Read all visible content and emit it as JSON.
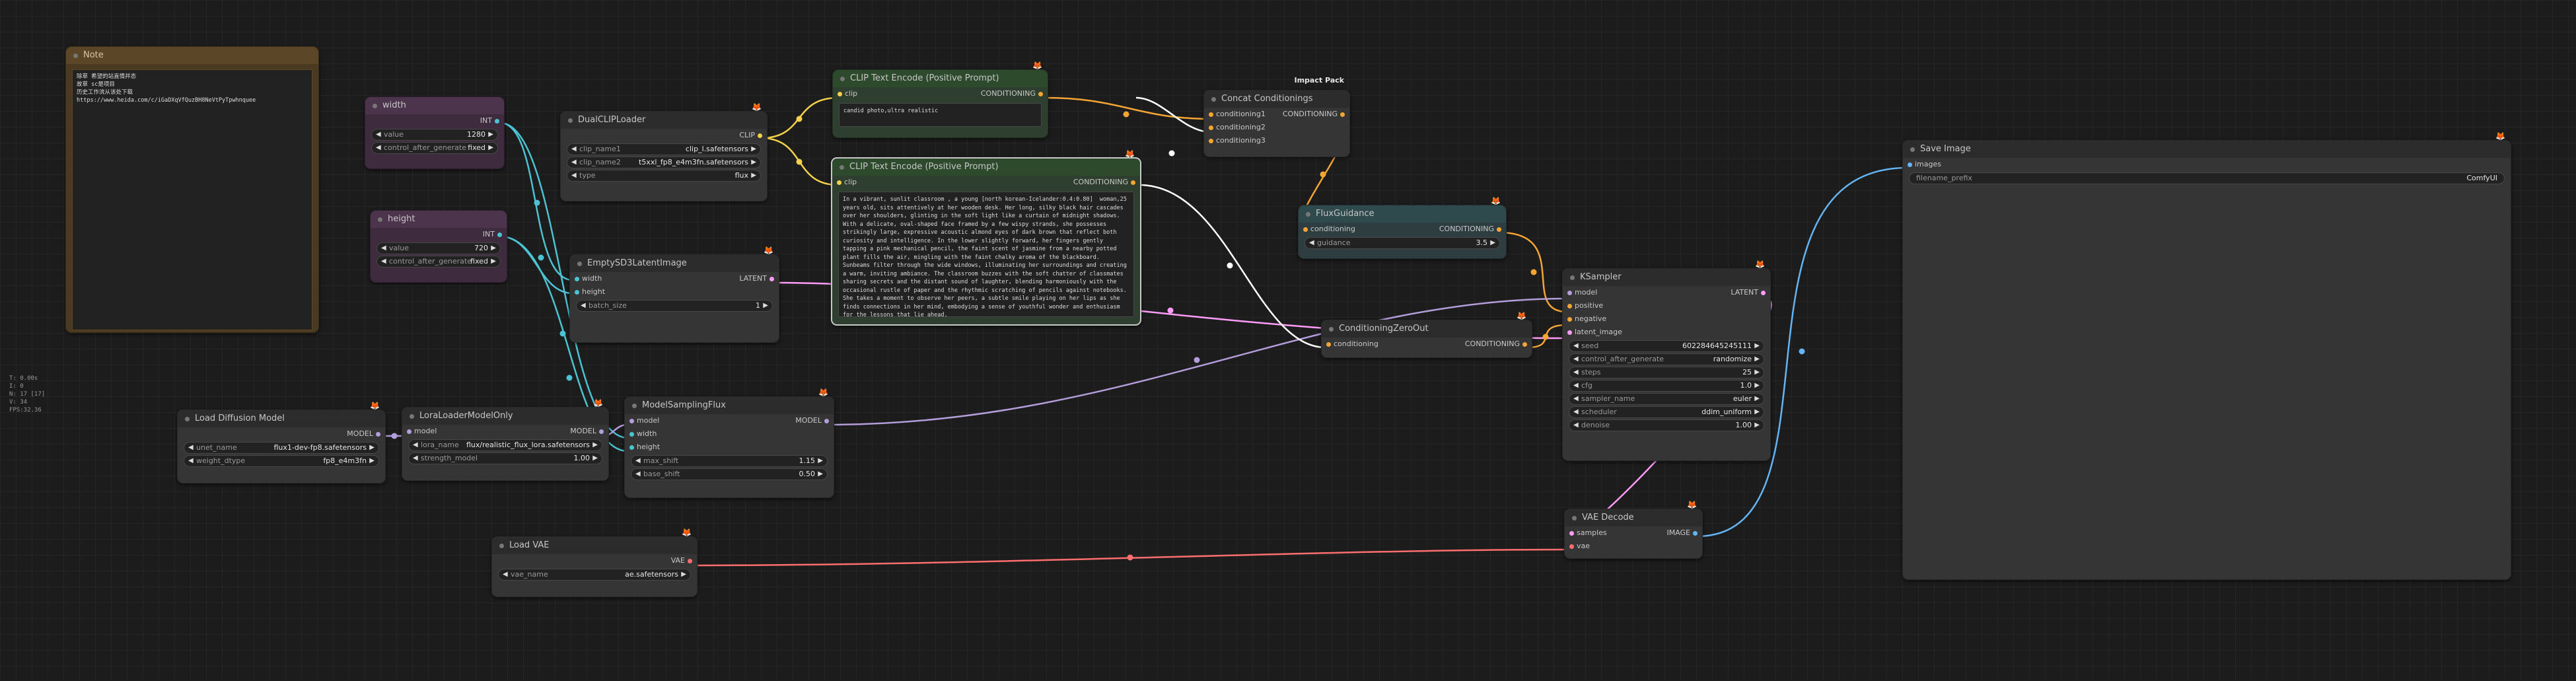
{
  "stats": [
    "T: 0.00s",
    "I: 0",
    "N: 17 [17]",
    "V: 34",
    "FPS:32.36"
  ],
  "note": {
    "title": "Note",
    "text": "除草 希望的站直情并态\n故草 sc是项目\n历史工作流从该处下载\nhttps://www.heida.com/c/iGaDXqVfQuzBH8NeVtPyTpwhnquee"
  },
  "width": {
    "title": "width",
    "out": "INT",
    "widgets": [
      {
        "name": "value",
        "value": "1280"
      },
      {
        "name": "control_after_generate",
        "value": "fixed"
      }
    ]
  },
  "height": {
    "title": "height",
    "out": "INT",
    "widgets": [
      {
        "name": "value",
        "value": "720"
      },
      {
        "name": "control_after_generate",
        "value": "fixed"
      }
    ]
  },
  "dualclip": {
    "title": "DualCLIPLoader",
    "out": "CLIP",
    "widgets": [
      {
        "name": "clip_name1",
        "value": "clip_l.safetensors"
      },
      {
        "name": "clip_name2",
        "value": "t5xxl_fp8_e4m3fn.safetensors"
      },
      {
        "name": "type",
        "value": "flux"
      }
    ]
  },
  "clip_small": {
    "title": "CLIP Text Encode (Positive Prompt)",
    "in": "clip",
    "out": "CONDITIONING",
    "text": "candid photo,ultra realistic"
  },
  "clip_big": {
    "title": "CLIP Text Encode (Positive Prompt)",
    "in": "clip",
    "out": "CONDITIONING",
    "text": "In a vibrant, sunlit classroom , a young [north korean-Icelander:0.4:0.80]  woman,25 years old, sits attentively at her wooden desk. Her long, silky black hair cascades over her shoulders, glinting in the soft light like a curtain of midnight shadows. With a delicate, oval-shaped face framed by a few wispy strands, she possesses strikingly large, expressive acoustic almond eyes of dark brown that reflect both curiosity and intelligence. In the lower slightly forward, her fingers gently tapping a pink mechanical pencil, the faint scent of jasmine from a nearby potted plant fills the air, mingling with the faint chalky aroma of the blackboard. Sunbeams filter through the wide windows, illuminating her surroundings and creating a warm, inviting ambiance. The classroom buzzes with the soft chatter of classmates sharing secrets and the distant sound of laughter, blending harmoniously with the occasional rustle of paper and the rhythmic scratching of pencils against notebooks. She takes a moment to observe her peers, a subtle smile playing on her lips as she finds connections in her mind, embodying a sense of youthful wonder and enthusiasm for the lessons that lie ahead."
  },
  "concat": {
    "title": "Concat Conditionings",
    "group": "Impact Pack",
    "inputs": [
      "conditioning1",
      "conditioning2",
      "conditioning3"
    ],
    "out": "CONDITIONING"
  },
  "fluxguidance": {
    "title": "FluxGuidance",
    "in": "conditioning",
    "out": "CONDITIONING",
    "widgets": [
      {
        "name": "guidance",
        "value": "3.5"
      }
    ]
  },
  "emptylatent": {
    "title": "EmptySD3LatentImage",
    "inputs": [
      "width",
      "height"
    ],
    "out": "LATENT",
    "widgets": [
      {
        "name": "batch_size",
        "value": "1"
      }
    ]
  },
  "condzero": {
    "title": "ConditioningZeroOut",
    "in": "conditioning",
    "out": "CONDITIONING"
  },
  "ksampler": {
    "title": "KSampler",
    "inputs": [
      "model",
      "positive",
      "negative",
      "latent_image"
    ],
    "out": "LATENT",
    "widgets": [
      {
        "name": "seed",
        "value": "602284645245111"
      },
      {
        "name": "control_after_generate",
        "value": "randomize"
      },
      {
        "name": "steps",
        "value": "25"
      },
      {
        "name": "cfg",
        "value": "1.0"
      },
      {
        "name": "sampler_name",
        "value": "euler"
      },
      {
        "name": "scheduler",
        "value": "ddim_uniform"
      },
      {
        "name": "denoise",
        "value": "1.00"
      }
    ]
  },
  "saveimage": {
    "title": "Save Image",
    "in": "images",
    "widgets": [
      {
        "name": "filename_prefix",
        "value": "ComfyUI"
      }
    ]
  },
  "loaddiff": {
    "title": "Load Diffusion Model",
    "out": "MODEL",
    "widgets": [
      {
        "name": "unet_name",
        "value": "flux1-dev-fp8.safetensors"
      },
      {
        "name": "weight_dtype",
        "value": "fp8_e4m3fn"
      }
    ]
  },
  "lora": {
    "title": "LoraLoaderModelOnly",
    "in": "model",
    "out": "MODEL",
    "widgets": [
      {
        "name": "lora_name",
        "value": "flux/realistic_flux_lora.safetensors"
      },
      {
        "name": "strength_model",
        "value": "1.00"
      }
    ]
  },
  "msflux": {
    "title": "ModelSamplingFlux",
    "inputs": [
      "model",
      "width",
      "height"
    ],
    "out": "MODEL",
    "widgets": [
      {
        "name": "max_shift",
        "value": "1.15"
      },
      {
        "name": "base_shift",
        "value": "0.50"
      }
    ]
  },
  "loadvae": {
    "title": "Load VAE",
    "out": "VAE",
    "widgets": [
      {
        "name": "vae_name",
        "value": "ae.safetensors"
      }
    ]
  },
  "vaedecode": {
    "title": "VAE Decode",
    "inputs": [
      "samples",
      "vae"
    ],
    "out": "IMAGE"
  },
  "colors": {
    "INT": "#4bc3d3",
    "CLIP": "#f5d24a",
    "CONDITIONING": "#f5a534",
    "LATENT": "#ff9cf9",
    "MODEL": "#b39ddb",
    "VAE": "#ff6e6e",
    "IMAGE": "#64b5f6"
  }
}
